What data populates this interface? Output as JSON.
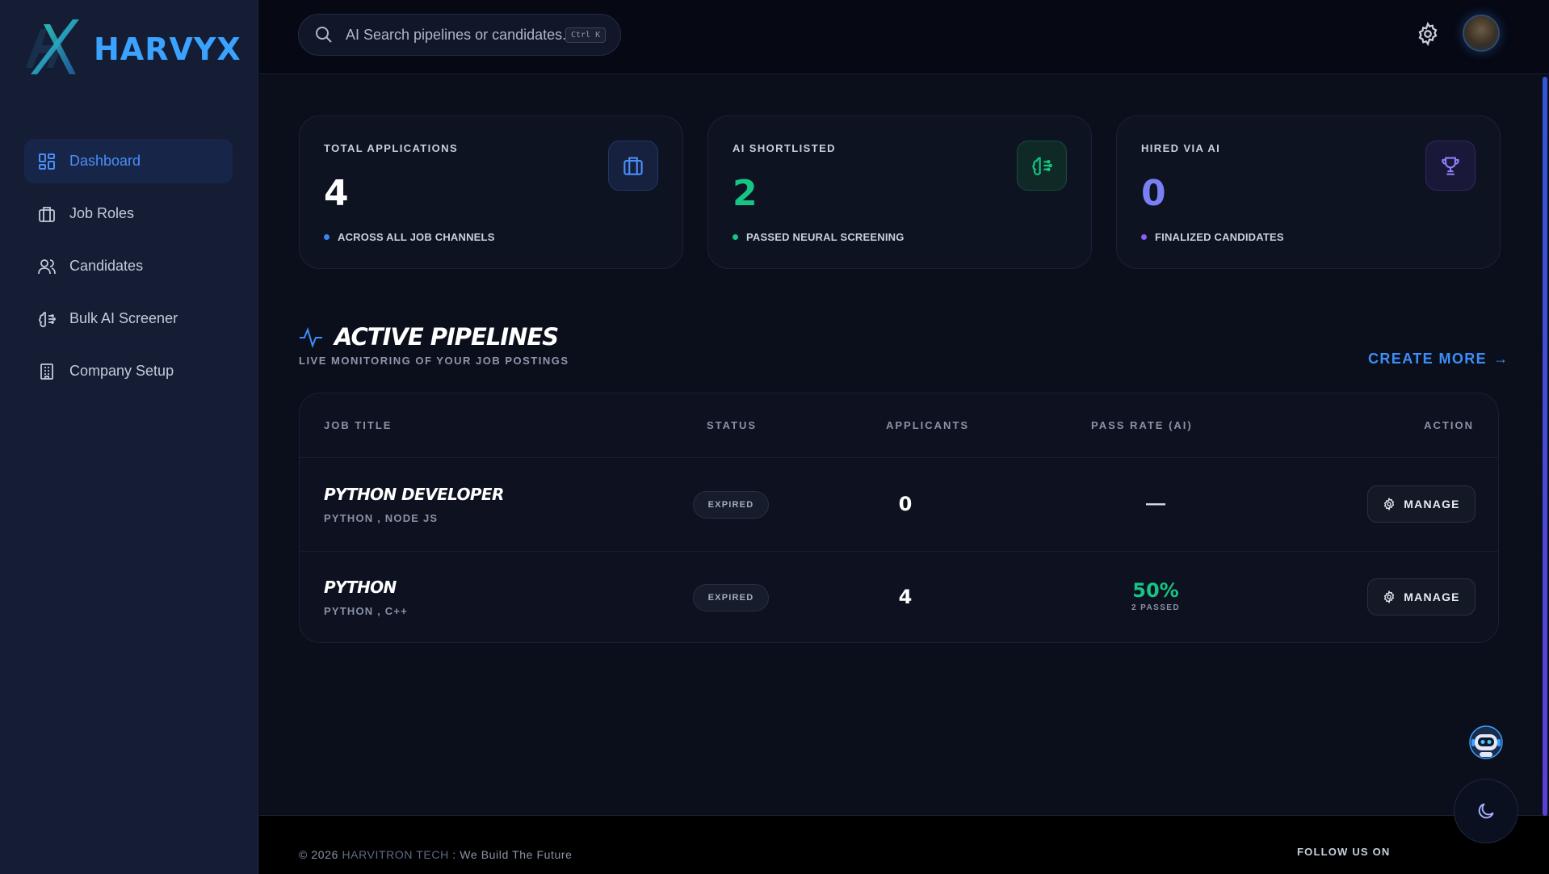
{
  "brand": {
    "name": "HARVYX",
    "color": "#3ba3ff"
  },
  "sidebar": {
    "items": [
      {
        "label": "Dashboard",
        "icon": "dashboard-grid-icon",
        "active": true
      },
      {
        "label": "Job Roles",
        "icon": "briefcase-icon"
      },
      {
        "label": "Candidates",
        "icon": "users-icon"
      },
      {
        "label": "Bulk AI Screener",
        "icon": "brain-icon"
      },
      {
        "label": "Company Setup",
        "icon": "building-icon"
      }
    ]
  },
  "topbar": {
    "search_placeholder": "AI Search pipelines or candidates...",
    "shortcut": "Ctrl K",
    "icons": [
      "search-icon",
      "gear-icon",
      "avatar"
    ]
  },
  "stats": [
    {
      "label": "TOTAL APPLICATIONS",
      "value": "4",
      "sub": "ACROSS ALL JOB CHANNELS",
      "color": "#ffffff",
      "dot": "#3b82f6",
      "icon": "briefcase-icon"
    },
    {
      "label": "AI SHORTLISTED",
      "value": "2",
      "sub": "PASSED NEURAL SCREENING",
      "color": "#16c483",
      "dot": "#16c483",
      "icon": "brain-icon"
    },
    {
      "label": "HIRED VIA AI",
      "value": "0",
      "sub": "FINALIZED CANDIDATES",
      "color": "#7b7ff5",
      "dot": "#8b5cf6",
      "icon": "trophy-icon"
    }
  ],
  "pipelines": {
    "title": "ACTIVE PIPELINES",
    "subtitle": "LIVE MONITORING OF YOUR JOB POSTINGS",
    "create_more": "CREATE MORE",
    "columns": [
      "JOB TITLE",
      "STATUS",
      "APPLICANTS",
      "PASS RATE (AI)",
      "ACTION"
    ],
    "rows": [
      {
        "title": "PYTHON DEVELOPER",
        "skills": "PYTHON , NODE JS",
        "status": "EXPIRED",
        "applicants": "0",
        "pass_rate": "—",
        "pass_sub": "",
        "action": "MANAGE"
      },
      {
        "title": "PYTHON",
        "skills": "PYTHON , C++",
        "status": "EXPIRED",
        "applicants": "4",
        "pass_rate": "50%",
        "pass_sub": "2 PASSED",
        "action": "MANAGE"
      }
    ]
  },
  "footer": {
    "copyright_prefix": "© 2026",
    "company": "HARVITRON TECH",
    "tagline": ": We Build The Future",
    "follow": "FOLLOW US ON"
  },
  "floating": {
    "assistant_icon": "robot-assistant-icon",
    "theme_icon": "moon-icon"
  }
}
